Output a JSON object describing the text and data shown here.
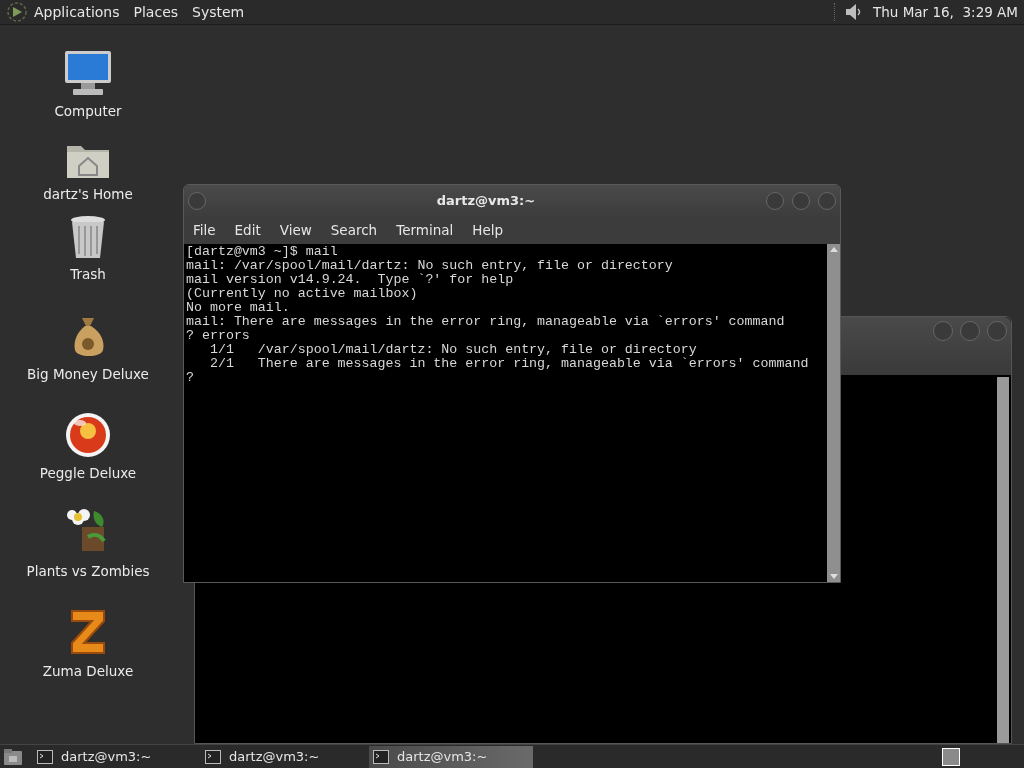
{
  "top_panel": {
    "menus": [
      {
        "label": "Applications"
      },
      {
        "label": "Places"
      },
      {
        "label": "System"
      }
    ],
    "clock": "Thu Mar 16,  3:29 AM"
  },
  "desktop_icons": [
    {
      "kind": "computer",
      "label": "Computer"
    },
    {
      "kind": "home",
      "label": "dartz's Home"
    },
    {
      "kind": "trash",
      "label": "Trash"
    },
    {
      "kind": "money",
      "label": "Big Money Deluxe"
    },
    {
      "kind": "peggle",
      "label": "Peggle Deluxe"
    },
    {
      "kind": "plants",
      "label": "Plants vs Zombies"
    },
    {
      "kind": "zuma",
      "label": "Zuma Deluxe"
    }
  ],
  "terminal": {
    "title": "dartz@vm3:~",
    "menu": [
      "File",
      "Edit",
      "View",
      "Search",
      "Terminal",
      "Help"
    ],
    "lines": [
      "[dartz@vm3 ~]$ mail",
      "mail: /var/spool/mail/dartz: No such entry, file or directory",
      "mail version v14.9.24.  Type `?' for help",
      "(Currently no active mailbox)",
      "No more mail.",
      "mail: There are messages in the error ring, manageable via `errors' command",
      "? errors",
      "   1/1   /var/spool/mail/dartz: No such entry, file or directory",
      "   2/1   There are messages in the error ring, manageable via `errors' command",
      "?"
    ]
  },
  "taskbar": {
    "items": [
      {
        "label": "dartz@vm3:~",
        "selected": false
      },
      {
        "label": "dartz@vm3:~",
        "selected": false
      },
      {
        "label": "dartz@vm3:~",
        "selected": true
      }
    ]
  }
}
